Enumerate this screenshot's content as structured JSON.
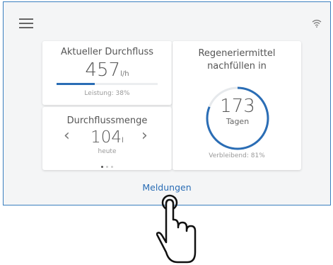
{
  "flow": {
    "title": "Aktueller Durchfluss",
    "value": "457",
    "unit": "l/h",
    "subtitle": "Leistung: 38%",
    "performance_percent": 38
  },
  "amount": {
    "title": "Durchflussmenge",
    "value": "104",
    "unit": "l",
    "period": "heute",
    "prev_icon": "chevron-left-icon",
    "next_icon": "chevron-right-icon",
    "pager_count": 3,
    "pager_active": 0
  },
  "regen": {
    "title_line1": "Regeneriermittel",
    "title_line2": "nachfüllen in",
    "value": "173",
    "unit": "Tagen",
    "remaining": "Verbleibend: 81%",
    "remaining_percent": 81
  },
  "footer": {
    "link_label": "Meldungen"
  },
  "colors": {
    "accent": "#2a6db5",
    "device_border": "#3a7fbf",
    "background": "#f4f5f6"
  },
  "icons": {
    "menu": "hamburger-menu-icon",
    "wifi": "wifi-icon",
    "pointer": "tap-hand-icon"
  }
}
